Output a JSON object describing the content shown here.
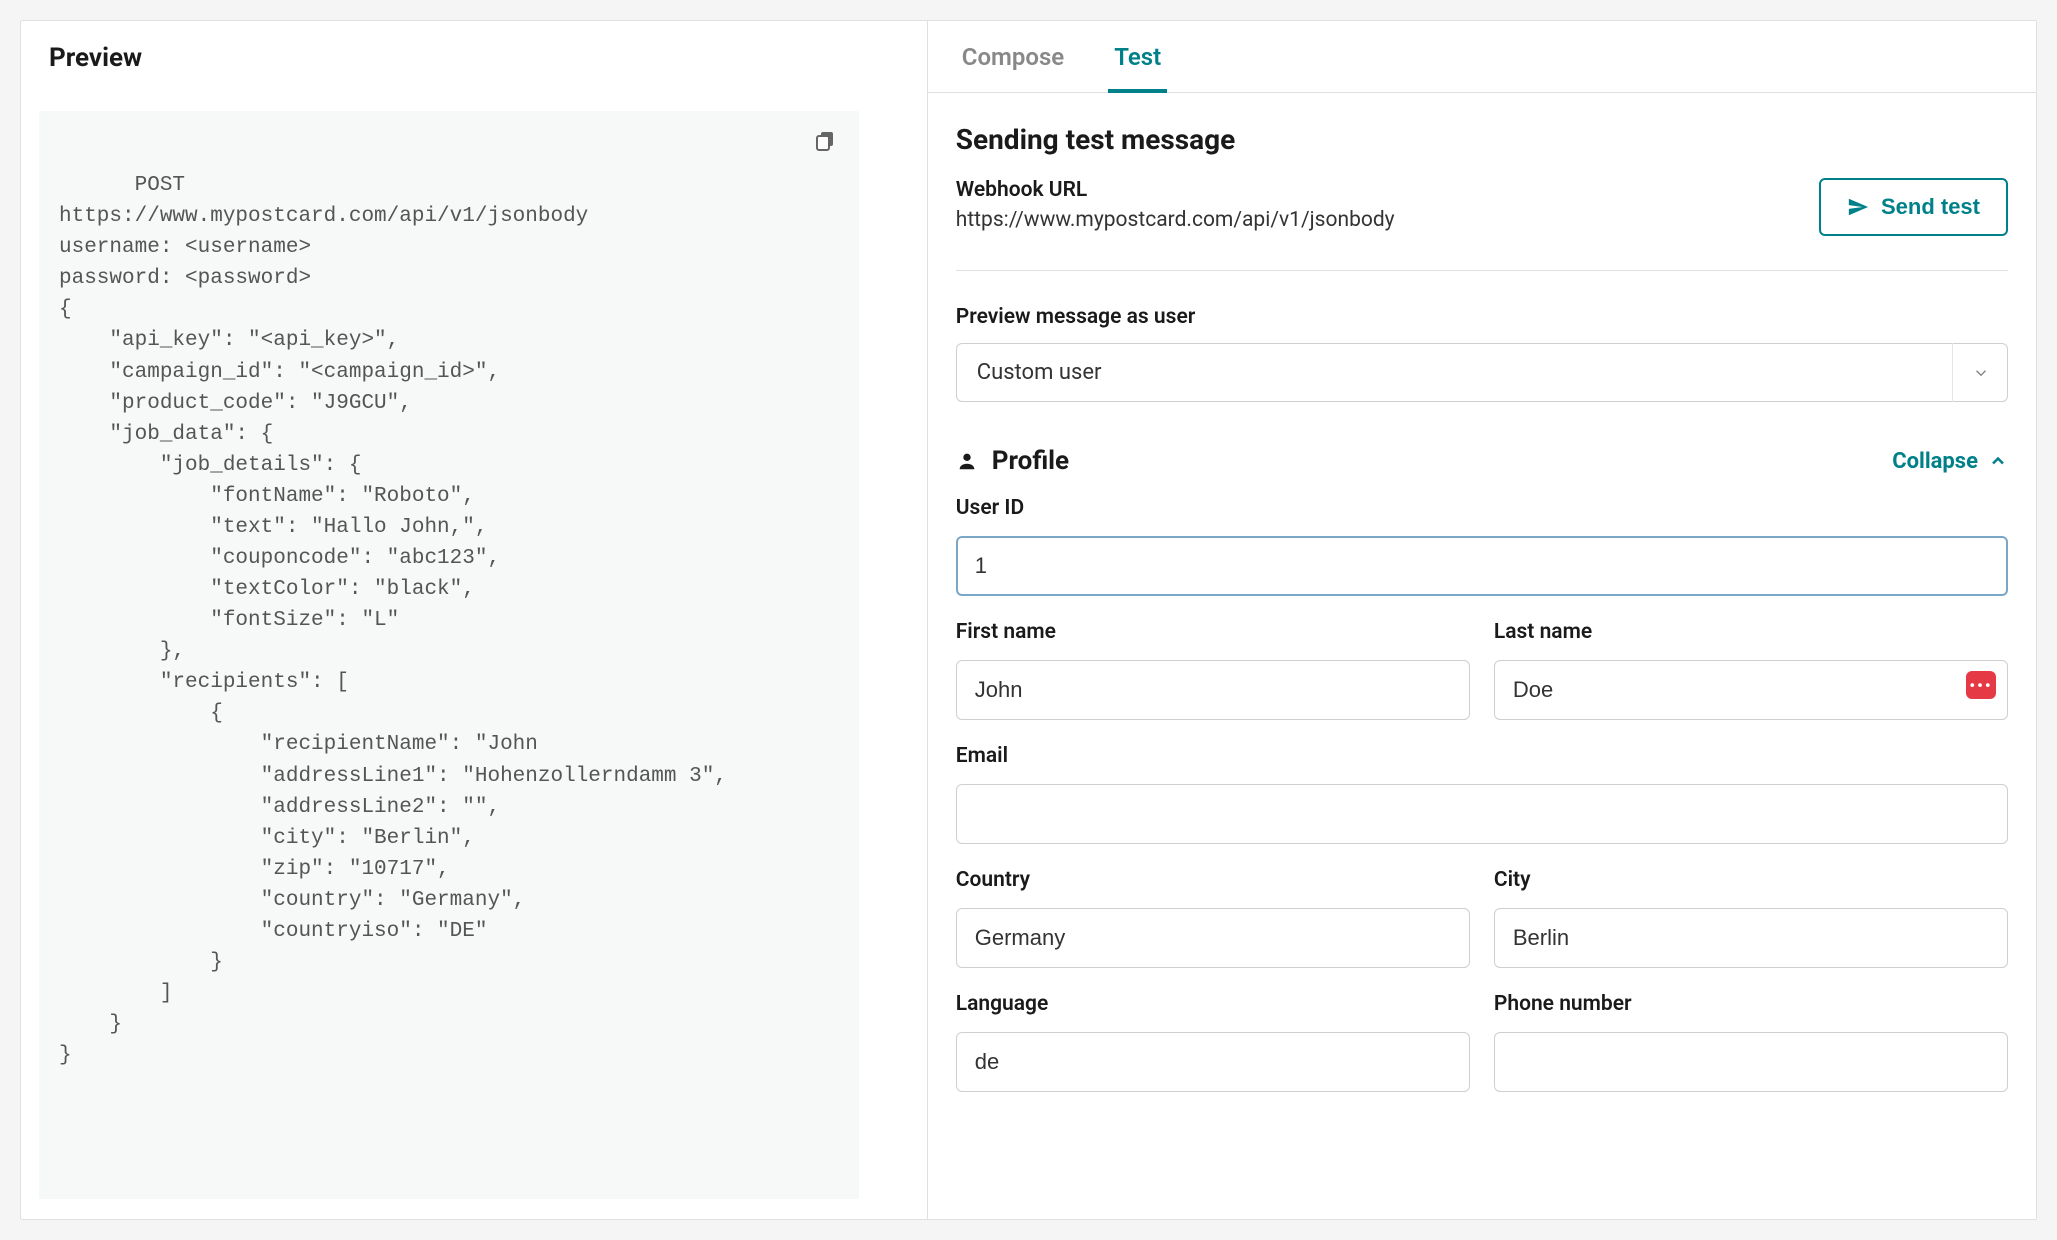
{
  "left": {
    "title": "Preview",
    "code": "POST\nhttps://www.mypostcard.com/api/v1/jsonbody\nusername: <username>\npassword: <password>\n{\n    \"api_key\": \"<api_key>\",\n    \"campaign_id\": \"<campaign_id>\",\n    \"product_code\": \"J9GCU\",\n    \"job_data\": {\n        \"job_details\": {\n            \"fontName\": \"Roboto\",\n            \"text\": \"Hallo John,\",\n            \"couponcode\": \"abc123\",\n            \"textColor\": \"black\",\n            \"fontSize\": \"L\"\n        },\n        \"recipients\": [\n            {\n                \"recipientName\": \"John\n                \"addressLine1\": \"Hohenzollerndamm 3\",\n                \"addressLine2\": \"\",\n                \"city\": \"Berlin\",\n                \"zip\": \"10717\",\n                \"country\": \"Germany\",\n                \"countryiso\": \"DE\"\n            }\n        ]\n    }\n}"
  },
  "tabs": {
    "compose": "Compose",
    "test": "Test",
    "active": "test"
  },
  "sending": {
    "title": "Sending test message",
    "webhook_label": "Webhook URL",
    "webhook_value": "https://www.mypostcard.com/api/v1/jsonbody",
    "send_test_label": "Send test"
  },
  "preview_user": {
    "label": "Preview message as user",
    "value": "Custom user"
  },
  "profile": {
    "title": "Profile",
    "collapse_label": "Collapse",
    "fields": {
      "user_id": {
        "label": "User ID",
        "value": "1"
      },
      "first_name": {
        "label": "First name",
        "value": "John"
      },
      "last_name": {
        "label": "Last name",
        "value": "Doe"
      },
      "email": {
        "label": "Email",
        "value": ""
      },
      "country": {
        "label": "Country",
        "value": "Germany"
      },
      "city": {
        "label": "City",
        "value": "Berlin"
      },
      "language": {
        "label": "Language",
        "value": "de"
      },
      "phone": {
        "label": "Phone number",
        "value": ""
      }
    }
  },
  "colors": {
    "accent": "#00818a",
    "danger": "#e63946"
  }
}
